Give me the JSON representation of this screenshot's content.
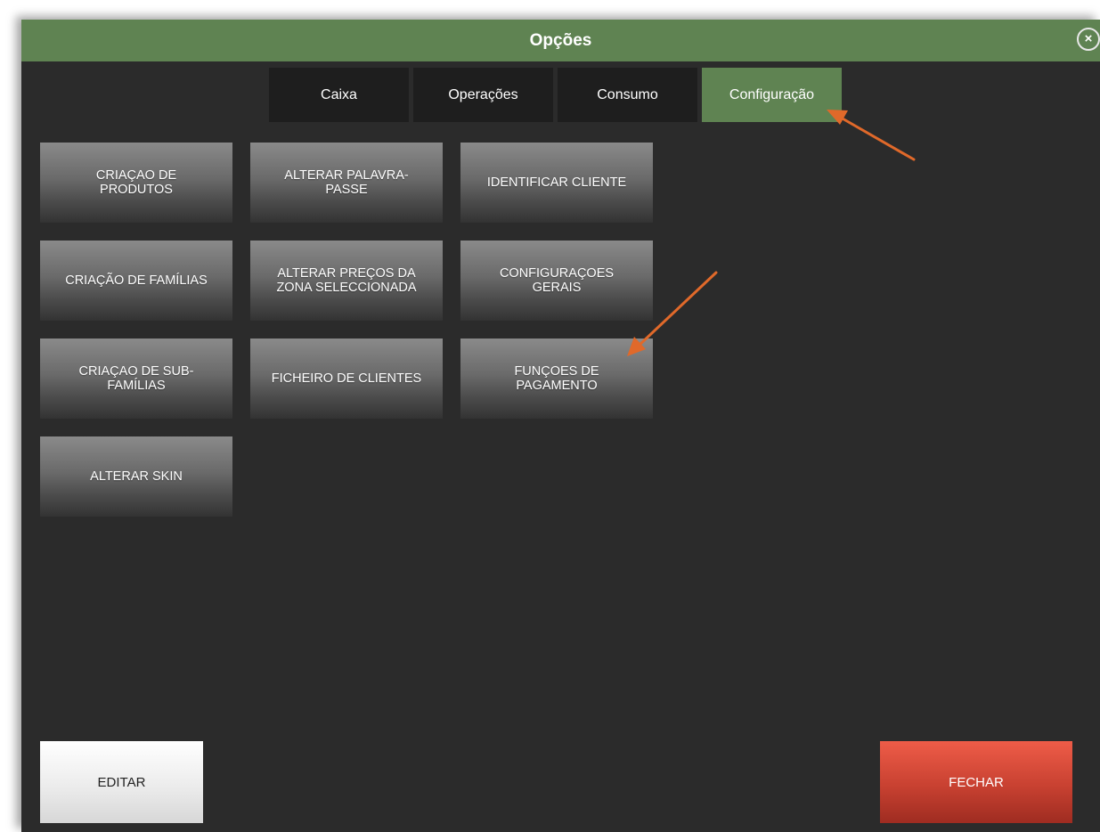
{
  "window": {
    "title": "Opções",
    "close_glyph": "×"
  },
  "tabs": [
    {
      "label": "Caixa",
      "active": false
    },
    {
      "label": "Operações",
      "active": false
    },
    {
      "label": "Consumo",
      "active": false
    },
    {
      "label": "Configuração",
      "active": true
    }
  ],
  "tiles": [
    {
      "label": "CRIAÇAO DE\nPRODUTOS"
    },
    {
      "label": "ALTERAR PALAVRA-\nPASSE"
    },
    {
      "label": "IDENTIFICAR CLIENTE"
    },
    {
      "label": "CRIAÇÃO DE FAMÍLIAS"
    },
    {
      "label": "ALTERAR PREÇOS DA\nZONA SELECCIONADA"
    },
    {
      "label": "CONFIGURAÇOES\nGERAIS"
    },
    {
      "label": "CRIAÇAO DE SUB-\nFAMÍLIAS"
    },
    {
      "label": "FICHEIRO DE CLIENTES"
    },
    {
      "label": "FUNÇOES DE\nPAGAMENTO"
    },
    {
      "label": "ALTERAR SKIN"
    }
  ],
  "footer": {
    "edit_label": "EDITAR",
    "close_label": "FECHAR"
  },
  "colors": {
    "accent_green": "#5f8352",
    "background": "#2b2b2b",
    "close_red": "#c84131",
    "annotation_arrow": "#e0692a"
  },
  "icons": {
    "close": "close-icon",
    "annotation": "arrow-icon"
  }
}
